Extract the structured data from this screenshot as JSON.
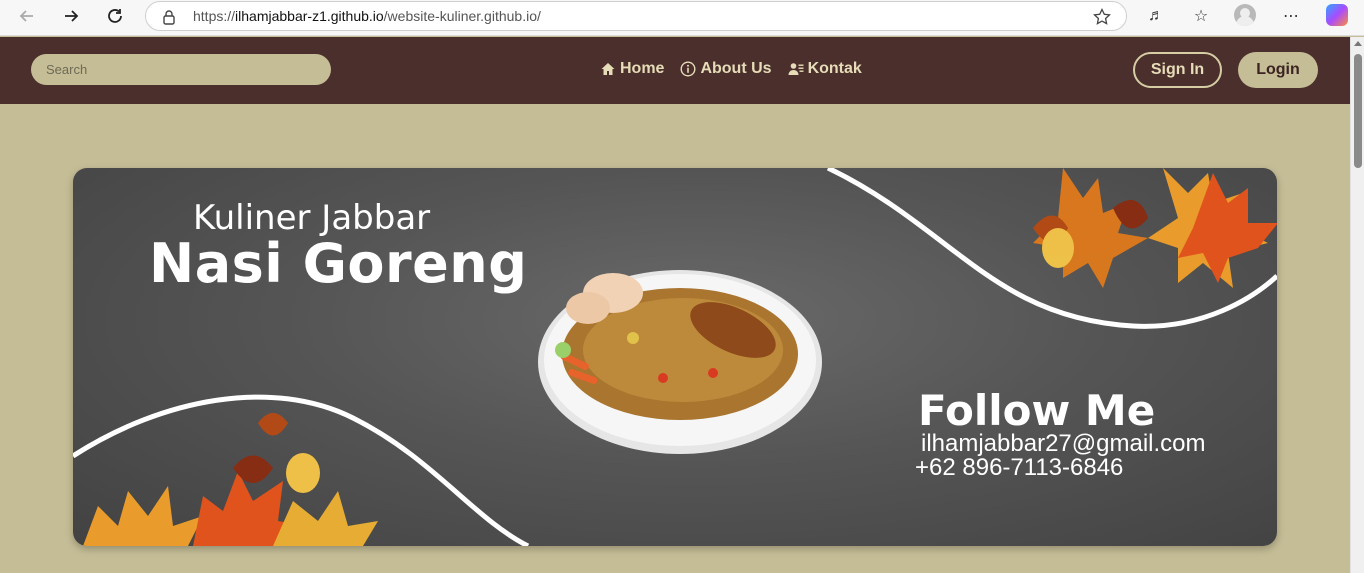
{
  "browser": {
    "url_prefix": "https://",
    "url_domain": "ilhamjabbar-z1.github.io",
    "url_path": "/website-kuliner.github.io/"
  },
  "navbar": {
    "search_placeholder": "Search",
    "links": [
      {
        "label": "Home",
        "icon": "home-icon"
      },
      {
        "label": "About Us",
        "icon": "info-icon"
      },
      {
        "label": "Kontak",
        "icon": "contact-icon"
      }
    ],
    "signin_label": "Sign In",
    "login_label": "Login"
  },
  "banner": {
    "subtitle": "Kuliner Jabbar",
    "title": "Nasi Goreng",
    "follow_label": "Follow Me",
    "email": "ilhamjabbar27@gmail.com",
    "phone": "+62 896-7113-6846"
  },
  "colors": {
    "page_bg": "#c5bd96",
    "nav_bg": "#4a2f2c",
    "nav_text": "#e6dcb8",
    "banner_bg": "#555555"
  }
}
